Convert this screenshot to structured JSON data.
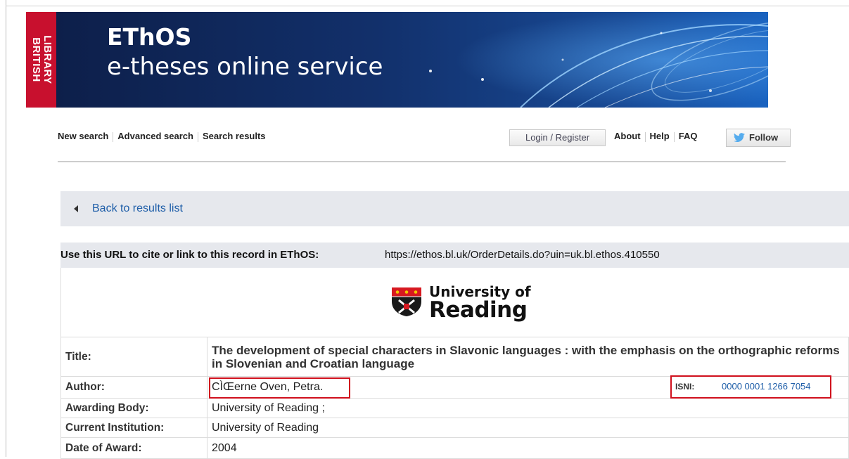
{
  "logo": {
    "line1": "BRITISH",
    "line2": "LIBRARY"
  },
  "banner": {
    "title": "EThOS",
    "subtitle": "e-theses online service"
  },
  "nav": {
    "left": [
      "New search",
      "Advanced search",
      "Search results"
    ],
    "login": "Login / Register",
    "right": [
      "About",
      "Help",
      "FAQ"
    ],
    "follow": "Follow"
  },
  "back_link": "Back to results list",
  "cite": {
    "label": "Use this URL to cite or link to this record in EThOS:",
    "url": "https://ethos.bl.uk/OrderDetails.do?uin=uk.bl.ethos.410550"
  },
  "institution_logo": {
    "line1": "University of",
    "line2": "Reading"
  },
  "record": [
    {
      "label": "Title:",
      "value": "The development of special characters in Slavonic languages : with the emphasis on the orthographic reforms in Slovenian and Croatian language"
    },
    {
      "label": "Author:",
      "value": "CÌŒerne Oven, Petra."
    },
    {
      "label": "Awarding Body:",
      "value": "University of Reading ;"
    },
    {
      "label": "Current Institution:",
      "value": "University of Reading"
    },
    {
      "label": "Date of Award:",
      "value": "2004"
    }
  ],
  "isni": {
    "label": "ISNI:",
    "value": "0000 0001 1266 7054"
  },
  "colors": {
    "brand_red": "#c8102e",
    "link_blue": "#1d5da8",
    "highlight_red": "#d0101d"
  }
}
